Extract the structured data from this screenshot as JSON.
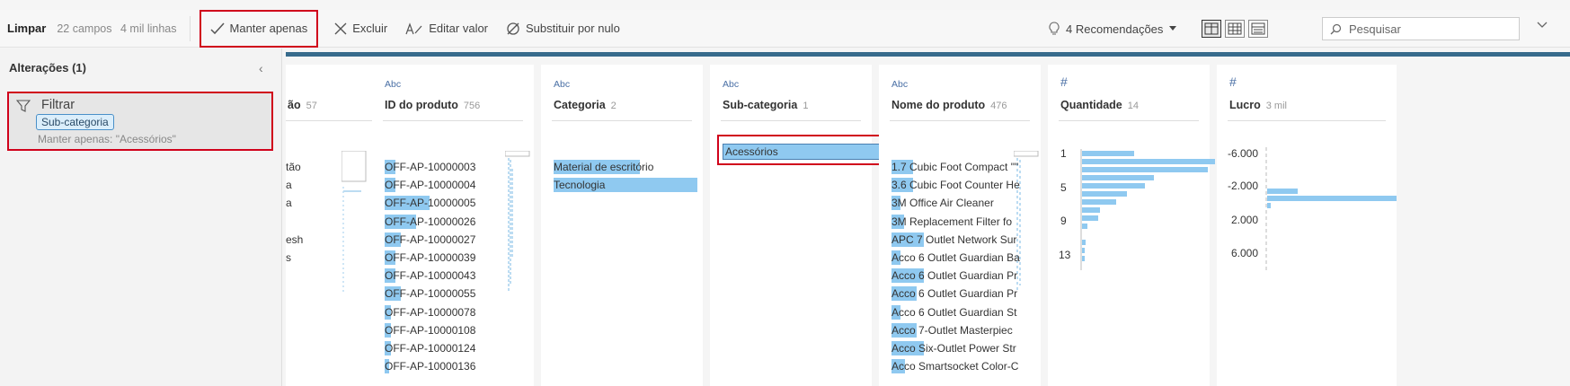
{
  "toolbar": {
    "clear": "Limpar",
    "fields": "22 campos",
    "rows": "4 mil linhas",
    "keep_only": "Manter apenas",
    "exclude": "Excluir",
    "edit_value": "Editar valor",
    "replace_null": "Substituir por nulo",
    "recommendations": "4 Recomendações",
    "search_placeholder": "Pesquisar"
  },
  "changes": {
    "title": "Alterações (1)",
    "item": {
      "title": "Filtrar",
      "field": "Sub-categoria",
      "description": "Manter apenas: \"Acessórios\""
    }
  },
  "columns": {
    "c0": {
      "name": "ão",
      "count": "57",
      "values": [
        "tão",
        "a",
        "a",
        "",
        "esh",
        "s"
      ]
    },
    "c1": {
      "type": "Abc",
      "name": "ID do produto",
      "count": "756",
      "values": [
        "OFF-AP-10000003",
        "OFF-AP-10000004",
        "OFF-AP-10000005",
        "OFF-AP-10000026",
        "OFF-AP-10000027",
        "OFF-AP-10000039",
        "OFF-AP-10000043",
        "OFF-AP-10000055",
        "OFF-AP-10000078",
        "OFF-AP-10000108",
        "OFF-AP-10000124",
        "OFF-AP-10000136"
      ],
      "fills": [
        0.12,
        0.12,
        0.5,
        0.35,
        0.18,
        0.12,
        0.12,
        0.18,
        0.07,
        0.07,
        0.07,
        0.05
      ]
    },
    "c2": {
      "type": "Abc",
      "name": "Categoria",
      "count": "2",
      "values": [
        "Material de escritório",
        "Tecnologia"
      ],
      "fills": [
        0.6,
        1.0
      ]
    },
    "c3": {
      "type": "Abc",
      "name": "Sub-categoria",
      "count": "1",
      "values": [
        "Acessórios"
      ]
    },
    "c4": {
      "type": "Abc",
      "name": "Nome do produto",
      "count": "476",
      "values": [
        "1.7 Cubic Foot Compact \"\"",
        "3.6 Cubic Foot Counter He",
        "3M Office Air Cleaner",
        "3M Replacement Filter fo",
        "APC 7 Outlet Network Sur",
        "Acco 6 Outlet Guardian Ba",
        "Acco 6 Outlet Guardian Pr",
        "Acco 6 Outlet Guardian Pr",
        "Acco 6 Outlet Guardian St",
        "Acco 7-Outlet Masterpiec",
        "Acco Six-Outlet Power Str",
        "Acco Smartsocket Color-C"
      ],
      "fills": [
        0.17,
        0.17,
        0.07,
        0.1,
        0.26,
        0.07,
        0.26,
        0.2,
        0.07,
        0.2,
        0.26,
        0.11
      ]
    },
    "c5": {
      "type": "#",
      "name": "Quantidade",
      "count": "14",
      "ticks": [
        "1",
        "5",
        "9",
        "13"
      ]
    },
    "c6": {
      "type": "#",
      "name": "Lucro",
      "count": "3 mil",
      "ticks": [
        "-6.000",
        "-2.000",
        "2.000",
        "6.000"
      ]
    }
  },
  "colors": {
    "accent_red": "#d0021b",
    "highlight_blue": "#8fc9f0",
    "header_bar": "#376b8c"
  }
}
